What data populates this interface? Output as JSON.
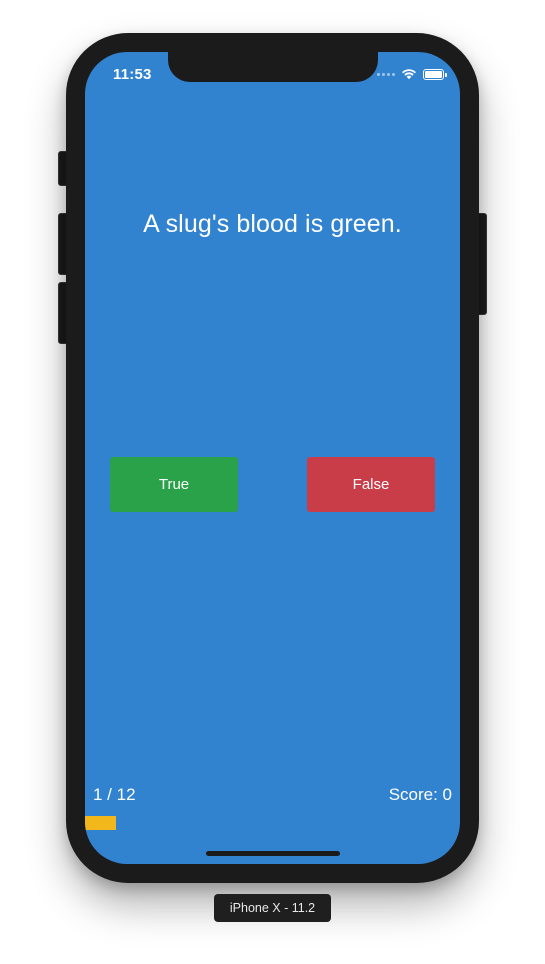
{
  "status_bar": {
    "time": "11:53",
    "icons": [
      "signal-dots-icon",
      "wifi-icon",
      "battery-icon"
    ]
  },
  "quiz": {
    "question": "A slug's blood is green.",
    "true_label": "True",
    "false_label": "False",
    "progress_text": "1 / 12",
    "score_text": "Score: 0",
    "progress_fraction": 0.0833
  },
  "simulator": {
    "device_label": "iPhone X - 11.2"
  },
  "colors": {
    "background": "#3182cf",
    "true_button": "#2aa24a",
    "false_button": "#c93d48",
    "progress_bar": "#f2b71a",
    "device_frame": "#1b1b1b"
  }
}
